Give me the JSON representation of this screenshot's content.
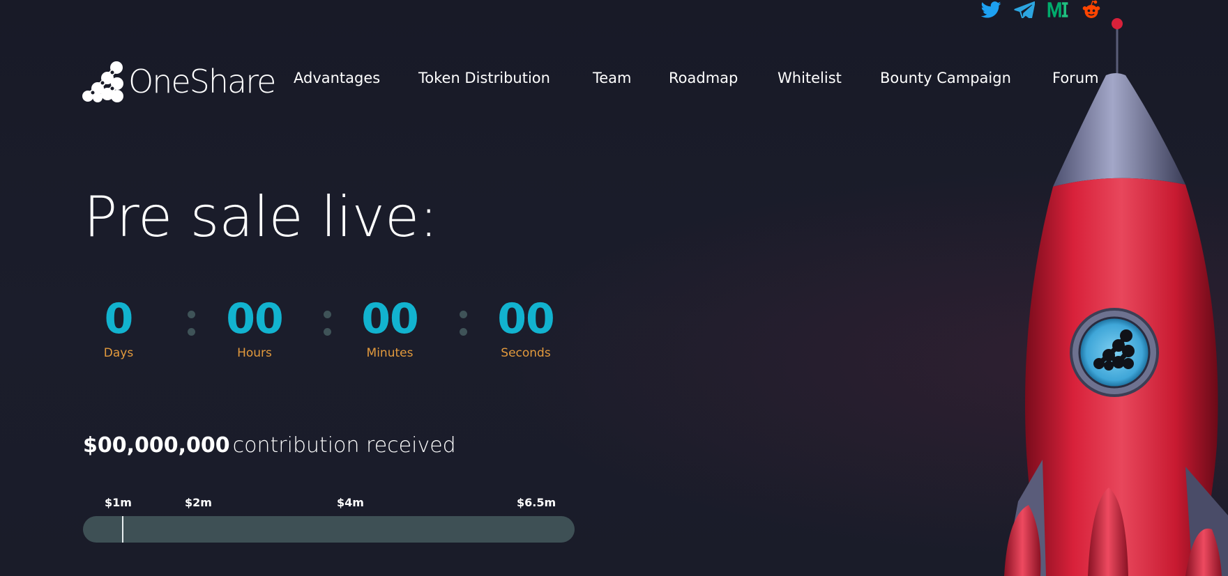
{
  "socials": [
    {
      "name": "twitter",
      "icon": "twitter-icon",
      "color": "#1da1f2"
    },
    {
      "name": "telegram",
      "icon": "telegram-icon",
      "color": "#2ca5e0"
    },
    {
      "name": "medium",
      "icon": "medium-icon",
      "color": "#00ab6c"
    },
    {
      "name": "reddit",
      "icon": "reddit-icon",
      "color": "#ff4500"
    }
  ],
  "header": {
    "logo_text": "OneShare",
    "nav": [
      "Advantages",
      "Token Distribution",
      "Team",
      "Roadmap",
      "Whitelist",
      "Bounty Campaign",
      "Forum"
    ]
  },
  "hero": {
    "title": "Pre sale live:",
    "countdown": [
      {
        "value": "0",
        "label": "Days"
      },
      {
        "value": "00",
        "label": "Hours"
      },
      {
        "value": "00",
        "label": "Minutes"
      },
      {
        "value": "00",
        "label": "Seconds"
      }
    ],
    "contribution_amount": "$00,000,000",
    "contribution_text": "contribution received",
    "milestones": [
      "$1m",
      "$2m",
      "$4m",
      "$6.5m"
    ],
    "progress_fraction": 0.0
  },
  "colors": {
    "background": "#181a26",
    "countdown_number": "#12b3cf",
    "countdown_label": "#e39a3d",
    "progress_track": "#3e5055",
    "rocket_body": "#d8213a"
  }
}
